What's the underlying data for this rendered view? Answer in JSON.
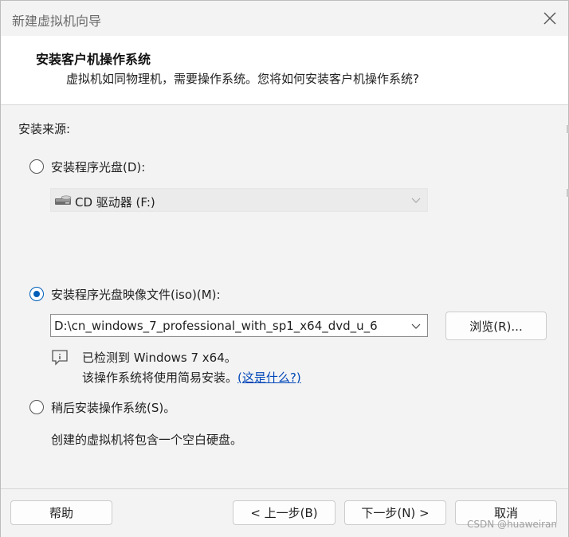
{
  "window": {
    "title": "新建虚拟机向导"
  },
  "header": {
    "title": "安装客户机操作系统",
    "subtitle": "虚拟机如同物理机，需要操作系统。您将如何安装客户机操作系统?"
  },
  "source": {
    "label": "安装来源:",
    "options": [
      {
        "label": "安装程序光盘(D):",
        "checked": false
      },
      {
        "label": "安装程序光盘映像文件(iso)(M):",
        "checked": true
      },
      {
        "label": "稍后安装操作系统(S)。",
        "checked": false
      }
    ],
    "disc_drive": {
      "value": "CD 驱动器 (F:)",
      "icon": "cd-drive-icon"
    },
    "iso_path": {
      "value": "D:\\cn_windows_7_professional_with_sp1_x64_dvd_u_6"
    },
    "browse_label": "浏览(R)...",
    "detected": {
      "icon": "info-icon",
      "line1": "已检测到 Windows 7 x64。",
      "line2_text": "该操作系统将使用简易安装。",
      "link": "(这是什么?)"
    },
    "later_desc": "创建的虚拟机将包含一个空白硬盘。"
  },
  "footer": {
    "help": "帮助",
    "back": "< 上一步(B)",
    "next": "下一步(N) >",
    "cancel": "取消"
  },
  "watermark": "CSDN @huaweiran",
  "colors": {
    "accent": "#005fb8",
    "link": "#0046b8",
    "background": "#f3f3f3",
    "header_bg": "#ffffff"
  }
}
